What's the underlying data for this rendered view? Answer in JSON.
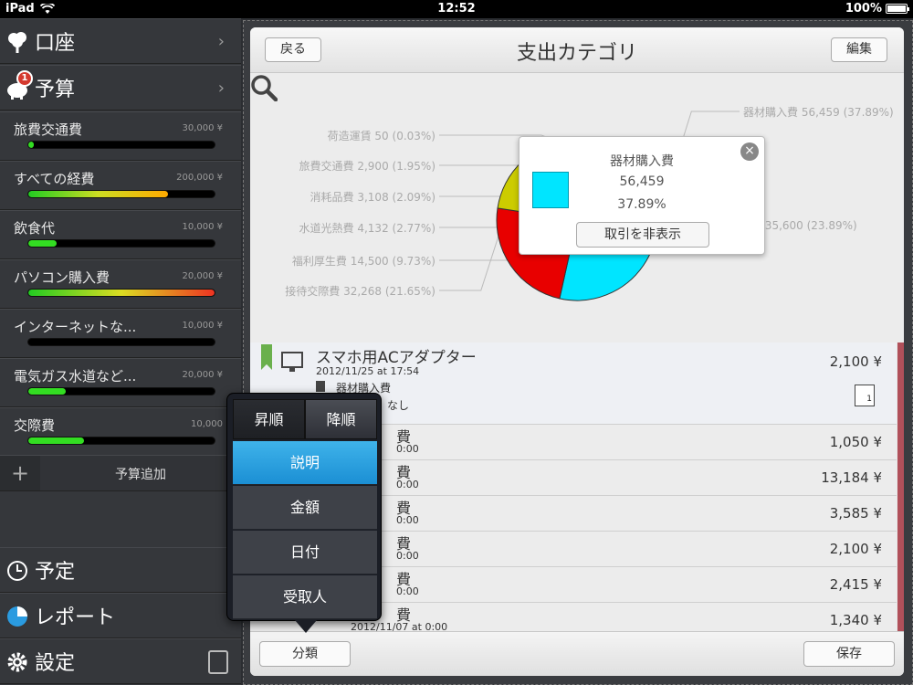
{
  "status": {
    "device": "iPad",
    "time": "12:52",
    "battery": "100%"
  },
  "sidebar": {
    "accounts_label": "口座",
    "budget_label": "予算",
    "budget_badge": "1",
    "budgets": [
      {
        "name": "旅費交通費",
        "amount": "30,000 ¥",
        "fill": 0.03,
        "color": "#33dd22"
      },
      {
        "name": "すべての経費",
        "amount": "200,000 ¥",
        "fill": 0.75,
        "color": "linear-gradient(90deg,#22cc22,#ccdd22,#ffaa00)"
      },
      {
        "name": "飲食代",
        "amount": "10,000 ¥",
        "fill": 0.15,
        "color": "#33dd22"
      },
      {
        "name": "パソコン購入費",
        "amount": "20,000 ¥",
        "fill": 1.0,
        "color": "linear-gradient(90deg,#22cc22,#dddd22,#ee3322)"
      },
      {
        "name": "インターネットな...",
        "amount": "10,000 ¥",
        "fill": 0.0,
        "color": "#33dd22"
      },
      {
        "name": "電気ガス水道など...",
        "amount": "20,000 ¥",
        "fill": 0.2,
        "color": "#33dd22"
      },
      {
        "name": "交際費",
        "amount": "10,000",
        "fill": 0.3,
        "color": "#33dd22"
      }
    ],
    "add_budget_label": "予算追加",
    "schedule_label": "予定",
    "report_label": "レポート",
    "settings_label": "設定"
  },
  "navbar": {
    "title": "支出カテゴリ",
    "back_label": "戻る",
    "edit_label": "編集"
  },
  "chart_data": {
    "type": "pie",
    "donut": true,
    "slices": [
      {
        "label": "器材購入費 56,459 (37.89%)",
        "value": 56459,
        "percent": 37.89,
        "color": "#00e5ff"
      },
      {
        "label": "地代家賃 35,600 (23.89%)",
        "value": 35600,
        "percent": 23.89,
        "color": "#e80000"
      },
      {
        "label": "接待交際費 32,268 (21.65%)",
        "value": 32268,
        "percent": 21.65,
        "color": "#cccc00"
      },
      {
        "label": "福利厚生費 14,500 (9.73%)",
        "value": 14500,
        "percent": 9.73,
        "color": "#22bb22"
      },
      {
        "label": "水道光熱費 4,132 (2.77%)",
        "value": 4132,
        "percent": 2.77,
        "color": "#dddddd"
      },
      {
        "label": "消耗品費 3,108 (2.09%)",
        "value": 3108,
        "percent": 2.09,
        "color": "#cc88cc"
      },
      {
        "label": "旅費交通費 2,900 (1.95%)",
        "value": 2900,
        "percent": 1.95,
        "color": "#88cc44"
      },
      {
        "label": "荷造運賃 50 (0.03%)",
        "value": 50,
        "percent": 0.03,
        "color": "#cccccc"
      }
    ]
  },
  "popup": {
    "title": "器材購入費",
    "value": "56,459",
    "percent": "37.89%",
    "hide_label": "取引を非表示"
  },
  "list": {
    "first": {
      "title": "スマホ用ACアダプター",
      "date": "2012/11/25 at 17:54",
      "category": "器材購入費",
      "payee_partial": "なし",
      "amount": "2,100 ¥",
      "attachments": "1"
    },
    "rows": [
      {
        "title_partial": "費",
        "date_partial": "0:00",
        "amount": "1,050 ¥"
      },
      {
        "title_partial": "費",
        "date_partial": "0:00",
        "amount": "13,184 ¥"
      },
      {
        "title_partial": "費",
        "date_partial": "0:00",
        "amount": "3,585 ¥"
      },
      {
        "title_partial": "費",
        "date_partial": "0:00",
        "amount": "2,100 ¥"
      },
      {
        "title_partial": "費",
        "date_partial": "0:00",
        "amount": "2,415 ¥"
      },
      {
        "title_partial": "費",
        "date_partial": "2012/11/07 at 0:00",
        "amount": "1,340 ¥"
      }
    ]
  },
  "toolbar": {
    "classify_label": "分類",
    "save_label": "保存"
  },
  "sort_popover": {
    "ascending": "昇順",
    "descending": "降順",
    "options": [
      "説明",
      "金額",
      "日付",
      "受取人"
    ],
    "selected_index": 0
  }
}
